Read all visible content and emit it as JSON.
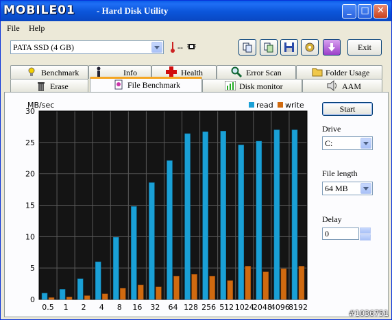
{
  "window": {
    "logo": "MOBILE01",
    "title": "- Hard Disk Utility",
    "minimize_label": "_",
    "maximize_label": "□",
    "close_label": "✕"
  },
  "menu": {
    "items": [
      "File",
      "Help"
    ]
  },
  "toolbar": {
    "drive": "PATA SSD (4 GB)",
    "temperature": "--",
    "exit_label": "Exit",
    "tool_icons": [
      "copy-icon",
      "copy-alt-icon",
      "save-icon",
      "settings-icon",
      "download-icon"
    ]
  },
  "tabs_top": [
    {
      "label": "Benchmark",
      "icon": "benchmark-icon"
    },
    {
      "label": "Info",
      "icon": "info-icon"
    },
    {
      "label": "Health",
      "icon": "health-icon"
    },
    {
      "label": "Error Scan",
      "icon": "search-icon"
    },
    {
      "label": "Folder Usage",
      "icon": "folder-icon"
    }
  ],
  "tabs_bottom": [
    {
      "label": "Erase",
      "icon": "trash-icon"
    },
    {
      "label": "File Benchmark",
      "icon": "file-benchmark-icon",
      "active": true
    },
    {
      "label": "Disk monitor",
      "icon": "chart-icon"
    },
    {
      "label": "AAM",
      "icon": "speaker-icon"
    }
  ],
  "controls": {
    "start_label": "Start",
    "drive_label": "Drive",
    "drive_value": "C:",
    "file_length_label": "File length",
    "file_length_value": "64 MB",
    "delay_label": "Delay",
    "delay_value": "0"
  },
  "colors": {
    "read": "#1aa0d6",
    "write": "#d06a10",
    "plot_bg": "#141414"
  },
  "chart_data": {
    "type": "bar",
    "ylabel": "MB/sec",
    "ylim": [
      0,
      30
    ],
    "yticks": [
      0,
      5,
      10,
      15,
      20,
      25,
      30
    ],
    "categories": [
      "0.5",
      "1",
      "2",
      "4",
      "8",
      "16",
      "32",
      "64",
      "128",
      "256",
      "512",
      "1024",
      "2048",
      "4096",
      "8192"
    ],
    "series": [
      {
        "name": "read",
        "values": [
          1.0,
          1.6,
          3.3,
          6.0,
          9.9,
          14.8,
          18.6,
          22.1,
          26.4,
          26.7,
          26.8,
          24.6,
          25.2,
          27.0,
          27.0
        ]
      },
      {
        "name": "write",
        "values": [
          0.3,
          0.4,
          0.6,
          0.9,
          1.8,
          2.3,
          2.0,
          3.7,
          4.0,
          3.7,
          3.0,
          5.3,
          4.4,
          4.9,
          5.3
        ]
      }
    ],
    "legend": "top-right",
    "grid": true
  },
  "watermark": "#1036751"
}
